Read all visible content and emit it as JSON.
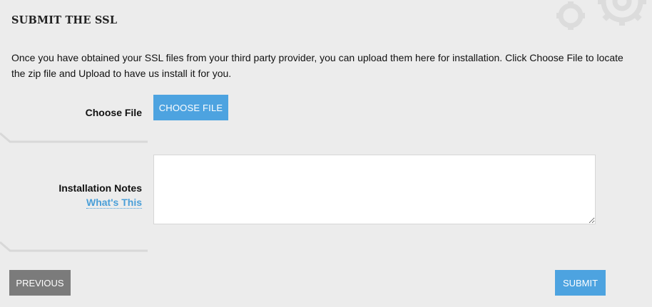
{
  "page": {
    "title": "SUBMIT THE SSL",
    "intro": "Once you have obtained your SSL files from your third party provider, you can upload them here for installation. Click Choose File to locate the zip file and Upload to have us install it for you."
  },
  "form": {
    "choose_file_label": "Choose File",
    "choose_file_button": "CHOOSE FILE",
    "notes_label": "Installation Notes",
    "whats_this_link": "What's This",
    "notes_value": ""
  },
  "actions": {
    "previous_label": "PREVIOUS",
    "submit_label": "SUBMIT"
  },
  "colors": {
    "background": "#ececec",
    "accent_blue": "#4da3e0",
    "previous_gray": "#7b7b7b",
    "link_blue": "#4a9fd8"
  },
  "icons": {
    "decoration": "gears-icon"
  }
}
